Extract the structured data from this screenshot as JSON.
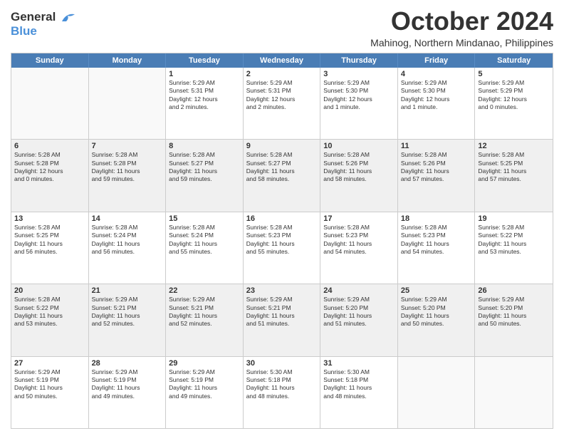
{
  "header": {
    "logo_line1": "General",
    "logo_line2": "Blue",
    "month": "October 2024",
    "location": "Mahinog, Northern Mindanao, Philippines"
  },
  "weekdays": [
    "Sunday",
    "Monday",
    "Tuesday",
    "Wednesday",
    "Thursday",
    "Friday",
    "Saturday"
  ],
  "rows": [
    [
      {
        "day": "",
        "lines": []
      },
      {
        "day": "",
        "lines": []
      },
      {
        "day": "1",
        "lines": [
          "Sunrise: 5:29 AM",
          "Sunset: 5:31 PM",
          "Daylight: 12 hours",
          "and 2 minutes."
        ]
      },
      {
        "day": "2",
        "lines": [
          "Sunrise: 5:29 AM",
          "Sunset: 5:31 PM",
          "Daylight: 12 hours",
          "and 2 minutes."
        ]
      },
      {
        "day": "3",
        "lines": [
          "Sunrise: 5:29 AM",
          "Sunset: 5:30 PM",
          "Daylight: 12 hours",
          "and 1 minute."
        ]
      },
      {
        "day": "4",
        "lines": [
          "Sunrise: 5:29 AM",
          "Sunset: 5:30 PM",
          "Daylight: 12 hours",
          "and 1 minute."
        ]
      },
      {
        "day": "5",
        "lines": [
          "Sunrise: 5:29 AM",
          "Sunset: 5:29 PM",
          "Daylight: 12 hours",
          "and 0 minutes."
        ]
      }
    ],
    [
      {
        "day": "6",
        "lines": [
          "Sunrise: 5:28 AM",
          "Sunset: 5:28 PM",
          "Daylight: 12 hours",
          "and 0 minutes."
        ]
      },
      {
        "day": "7",
        "lines": [
          "Sunrise: 5:28 AM",
          "Sunset: 5:28 PM",
          "Daylight: 11 hours",
          "and 59 minutes."
        ]
      },
      {
        "day": "8",
        "lines": [
          "Sunrise: 5:28 AM",
          "Sunset: 5:27 PM",
          "Daylight: 11 hours",
          "and 59 minutes."
        ]
      },
      {
        "day": "9",
        "lines": [
          "Sunrise: 5:28 AM",
          "Sunset: 5:27 PM",
          "Daylight: 11 hours",
          "and 58 minutes."
        ]
      },
      {
        "day": "10",
        "lines": [
          "Sunrise: 5:28 AM",
          "Sunset: 5:26 PM",
          "Daylight: 11 hours",
          "and 58 minutes."
        ]
      },
      {
        "day": "11",
        "lines": [
          "Sunrise: 5:28 AM",
          "Sunset: 5:26 PM",
          "Daylight: 11 hours",
          "and 57 minutes."
        ]
      },
      {
        "day": "12",
        "lines": [
          "Sunrise: 5:28 AM",
          "Sunset: 5:25 PM",
          "Daylight: 11 hours",
          "and 57 minutes."
        ]
      }
    ],
    [
      {
        "day": "13",
        "lines": [
          "Sunrise: 5:28 AM",
          "Sunset: 5:25 PM",
          "Daylight: 11 hours",
          "and 56 minutes."
        ]
      },
      {
        "day": "14",
        "lines": [
          "Sunrise: 5:28 AM",
          "Sunset: 5:24 PM",
          "Daylight: 11 hours",
          "and 56 minutes."
        ]
      },
      {
        "day": "15",
        "lines": [
          "Sunrise: 5:28 AM",
          "Sunset: 5:24 PM",
          "Daylight: 11 hours",
          "and 55 minutes."
        ]
      },
      {
        "day": "16",
        "lines": [
          "Sunrise: 5:28 AM",
          "Sunset: 5:23 PM",
          "Daylight: 11 hours",
          "and 55 minutes."
        ]
      },
      {
        "day": "17",
        "lines": [
          "Sunrise: 5:28 AM",
          "Sunset: 5:23 PM",
          "Daylight: 11 hours",
          "and 54 minutes."
        ]
      },
      {
        "day": "18",
        "lines": [
          "Sunrise: 5:28 AM",
          "Sunset: 5:23 PM",
          "Daylight: 11 hours",
          "and 54 minutes."
        ]
      },
      {
        "day": "19",
        "lines": [
          "Sunrise: 5:28 AM",
          "Sunset: 5:22 PM",
          "Daylight: 11 hours",
          "and 53 minutes."
        ]
      }
    ],
    [
      {
        "day": "20",
        "lines": [
          "Sunrise: 5:28 AM",
          "Sunset: 5:22 PM",
          "Daylight: 11 hours",
          "and 53 minutes."
        ]
      },
      {
        "day": "21",
        "lines": [
          "Sunrise: 5:29 AM",
          "Sunset: 5:21 PM",
          "Daylight: 11 hours",
          "and 52 minutes."
        ]
      },
      {
        "day": "22",
        "lines": [
          "Sunrise: 5:29 AM",
          "Sunset: 5:21 PM",
          "Daylight: 11 hours",
          "and 52 minutes."
        ]
      },
      {
        "day": "23",
        "lines": [
          "Sunrise: 5:29 AM",
          "Sunset: 5:21 PM",
          "Daylight: 11 hours",
          "and 51 minutes."
        ]
      },
      {
        "day": "24",
        "lines": [
          "Sunrise: 5:29 AM",
          "Sunset: 5:20 PM",
          "Daylight: 11 hours",
          "and 51 minutes."
        ]
      },
      {
        "day": "25",
        "lines": [
          "Sunrise: 5:29 AM",
          "Sunset: 5:20 PM",
          "Daylight: 11 hours",
          "and 50 minutes."
        ]
      },
      {
        "day": "26",
        "lines": [
          "Sunrise: 5:29 AM",
          "Sunset: 5:20 PM",
          "Daylight: 11 hours",
          "and 50 minutes."
        ]
      }
    ],
    [
      {
        "day": "27",
        "lines": [
          "Sunrise: 5:29 AM",
          "Sunset: 5:19 PM",
          "Daylight: 11 hours",
          "and 50 minutes."
        ]
      },
      {
        "day": "28",
        "lines": [
          "Sunrise: 5:29 AM",
          "Sunset: 5:19 PM",
          "Daylight: 11 hours",
          "and 49 minutes."
        ]
      },
      {
        "day": "29",
        "lines": [
          "Sunrise: 5:29 AM",
          "Sunset: 5:19 PM",
          "Daylight: 11 hours",
          "and 49 minutes."
        ]
      },
      {
        "day": "30",
        "lines": [
          "Sunrise: 5:30 AM",
          "Sunset: 5:18 PM",
          "Daylight: 11 hours",
          "and 48 minutes."
        ]
      },
      {
        "day": "31",
        "lines": [
          "Sunrise: 5:30 AM",
          "Sunset: 5:18 PM",
          "Daylight: 11 hours",
          "and 48 minutes."
        ]
      },
      {
        "day": "",
        "lines": []
      },
      {
        "day": "",
        "lines": []
      }
    ]
  ]
}
